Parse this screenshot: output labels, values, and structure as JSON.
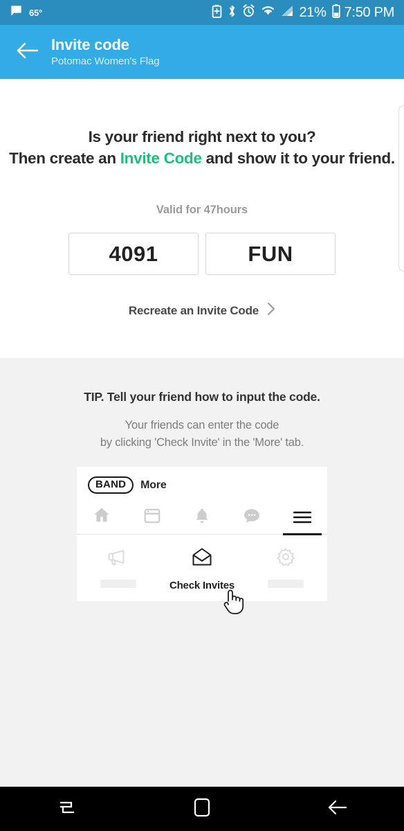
{
  "status_bar": {
    "message_icon": "chat-bubble-icon",
    "temperature": "65°",
    "icons": [
      "battery-saver-icon",
      "bluetooth-icon",
      "alarm-icon",
      "wifi-icon",
      "signal-icon"
    ],
    "battery_percent": "21%",
    "battery_icon": "battery-icon",
    "time": "7:50 PM",
    "background_color": "#2b8cbe"
  },
  "app_bar": {
    "back_icon": "back-arrow-icon",
    "title": "Invite code",
    "subtitle": "Potomac Women's Flag",
    "background_color": "#33abe4"
  },
  "main": {
    "headline_line1": "Is your friend right next to you?",
    "headline_line2_before": "Then create an ",
    "headline_accent": "Invite Code",
    "headline_line2_after": " and show it to your friend.",
    "accent_color": "#17c27c",
    "validity": "Valid for 47hours",
    "code_parts": [
      "4091",
      "FUN"
    ],
    "recreate_label": "Recreate an Invite Code",
    "recreate_chevron": "chevron-right-icon"
  },
  "tip": {
    "title": "TIP. Tell your friend how to input the code.",
    "body_line1": "Your friends can enter the code",
    "body_line2": "by clicking 'Check Invite' in the 'More' tab."
  },
  "illustration": {
    "brand": "BAND",
    "screen_label": "More",
    "tabs": [
      {
        "icon": "home-icon",
        "active": false
      },
      {
        "icon": "board-icon",
        "active": false
      },
      {
        "icon": "bell-icon",
        "active": false
      },
      {
        "icon": "chat-icon",
        "active": false
      },
      {
        "icon": "hamburger-menu-icon",
        "active": true
      }
    ],
    "menu_items": [
      {
        "icon": "megaphone-icon",
        "label": ""
      },
      {
        "icon": "open-envelope-icon",
        "label": "Check Invites"
      },
      {
        "icon": "gear-icon",
        "label": ""
      }
    ],
    "cursor": "pointing-hand-cursor"
  },
  "nav_bar": {
    "recents": "recents-icon",
    "home": "home-square-icon",
    "back": "back-arrow-icon"
  }
}
